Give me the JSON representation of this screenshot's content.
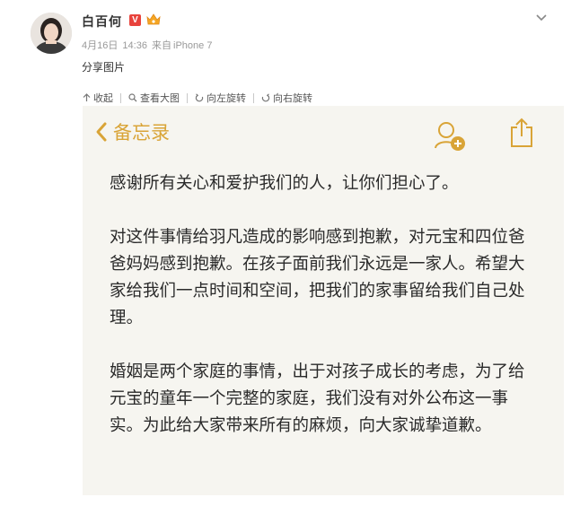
{
  "post": {
    "author": "白百何",
    "verified_badge": "V",
    "date": "4月16日",
    "time": "14:36",
    "source_prefix": "来自",
    "source_device": "iPhone 7",
    "text": "分享图片"
  },
  "icons": {
    "avatar": "avatar-photo",
    "vip": "vip-crown-icon",
    "expand": "chevron-down-icon"
  },
  "toolbar": {
    "collapse": "收起",
    "view_large": "查看大图",
    "rotate_left": "向左旋转",
    "rotate_right": "向右旋转"
  },
  "notes": {
    "back_label": "备忘录",
    "accent_color": "#d9a437",
    "paragraphs": [
      "感谢所有关心和爱护我们的人，让你们担心了。",
      "对这件事情给羽凡造成的影响感到抱歉，对元宝和四位爸爸妈妈感到抱歉。在孩子面前我们永远是一家人。希望大家给我们一点时间和空间，把我们的家事留给我们自己处理。",
      "婚姻是两个家庭的事情，出于对孩子成长的考虑，为了给元宝的童年一个完整的家庭，我们没有对外公布这一事实。为此给大家带来所有的麻烦，向大家诚挚道歉。"
    ]
  }
}
